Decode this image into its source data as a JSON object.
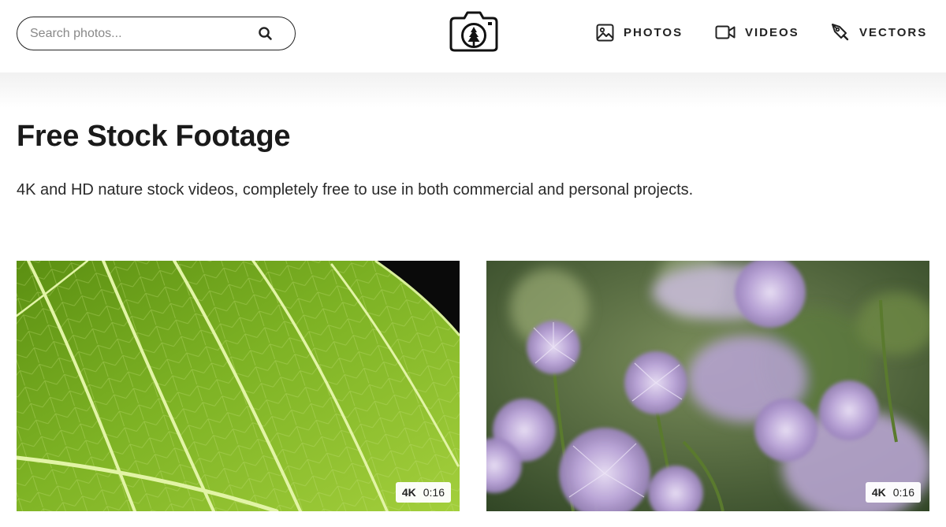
{
  "search": {
    "placeholder": "Search photos...",
    "value": ""
  },
  "nav": {
    "photos": "PHOTOS",
    "videos": "VIDEOS",
    "vectors": "VECTORS"
  },
  "icons": {
    "search": "search-icon",
    "logo": "camera-tree-logo",
    "photos": "image-icon",
    "videos": "video-camera-icon",
    "vectors": "pen-tool-icon"
  },
  "page": {
    "title": "Free Stock Footage",
    "subtitle": "4K and HD nature stock videos, completely free to use in both commercial and personal projects."
  },
  "videos": [
    {
      "resolution": "4K",
      "duration": "0:16"
    },
    {
      "resolution": "4K",
      "duration": "0:16"
    }
  ],
  "colors": {
    "text": "#1a1a1a",
    "leaf_green": "#6fa21c",
    "flower_purple": "#b9a4d6",
    "bokeh_green": "#4f6b3a"
  }
}
